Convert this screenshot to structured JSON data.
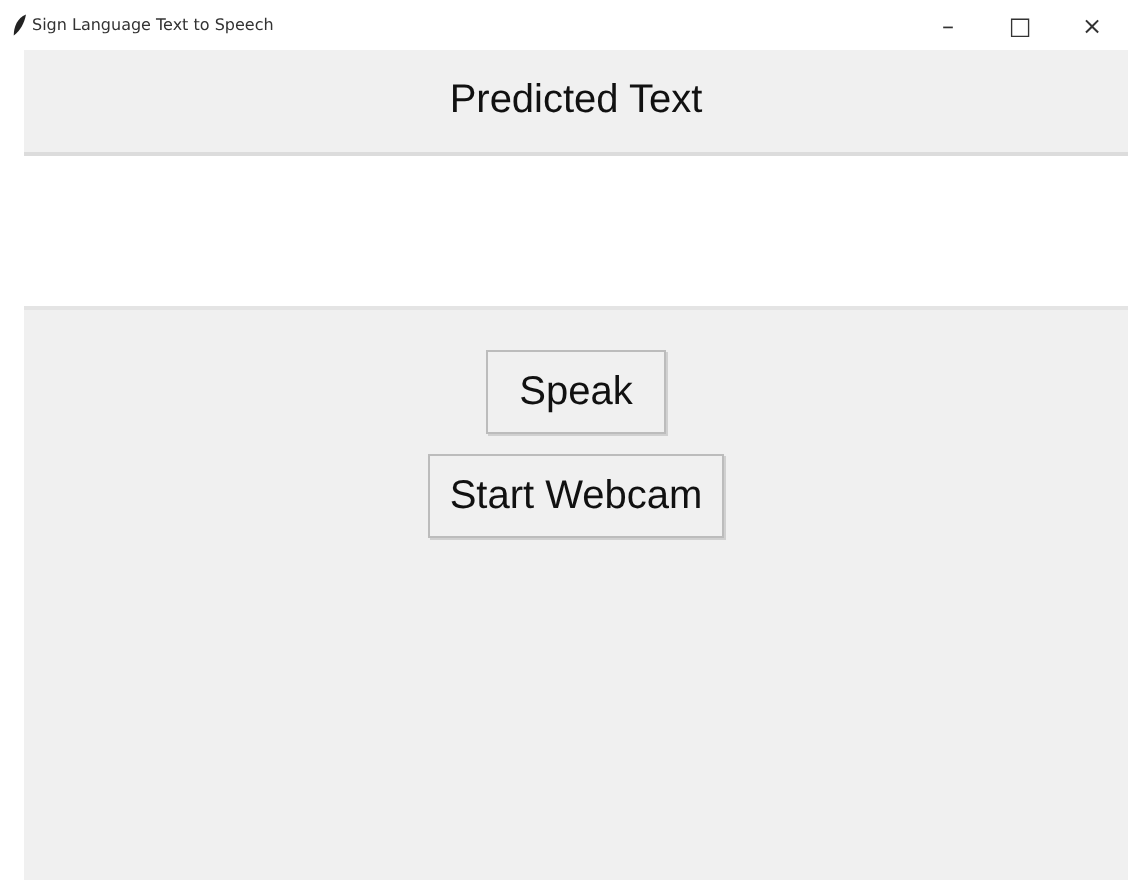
{
  "window": {
    "title": "Sign Language Text to Speech",
    "controls": [
      "–",
      "□",
      "×"
    ]
  },
  "heading": "Predicted Text",
  "buttons": [
    {
      "label": "Speak"
    },
    {
      "label": "Start Webcam"
    }
  ]
}
